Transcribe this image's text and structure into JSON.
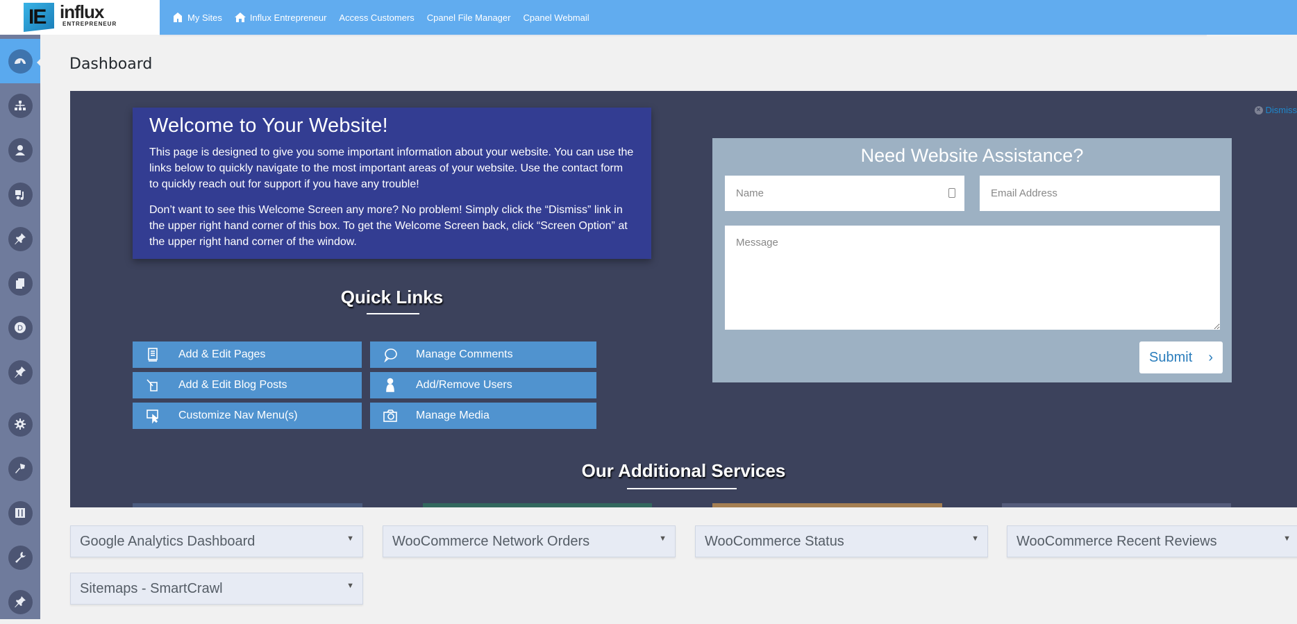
{
  "brand": {
    "mark": "IE",
    "name": "influx",
    "sub": "ENTREPRENEUR"
  },
  "topnav": [
    {
      "label": "My Sites",
      "icon": "sites-icon"
    },
    {
      "label": "Influx Entrepreneur",
      "icon": "home-icon"
    },
    {
      "label": "Access Customers",
      "icon": ""
    },
    {
      "label": "Cpanel File Manager",
      "icon": ""
    },
    {
      "label": "Cpanel Webmail",
      "icon": ""
    }
  ],
  "sidebar": [
    {
      "name": "dashboard",
      "icon": "dashboard-icon",
      "active": true
    },
    {
      "name": "my-sites",
      "icon": "sitemap-icon"
    },
    {
      "name": "users",
      "icon": "user-icon"
    },
    {
      "name": "media",
      "icon": "media-icon"
    },
    {
      "name": "posts",
      "icon": "pin-icon"
    },
    {
      "name": "pages",
      "icon": "pages-icon"
    },
    {
      "name": "divi",
      "icon": "divi-icon"
    },
    {
      "name": "pin-2",
      "icon": "pin-icon"
    },
    {
      "name": "settings",
      "icon": "gear-icon"
    },
    {
      "name": "appearance",
      "icon": "brush-icon"
    },
    {
      "name": "plugins",
      "icon": "sliders-icon"
    },
    {
      "name": "tools",
      "icon": "wrench-icon"
    },
    {
      "name": "pin-3",
      "icon": "pin-icon"
    }
  ],
  "page": {
    "title": "Dashboard"
  },
  "welcome": {
    "title": "Welcome to Your Website!",
    "p1": "This page is designed to give you some important information about your website. You can use the links below to quickly navigate to the most important areas of your website. Use the contact form to quickly reach out for support if you have any trouble!",
    "p2": "Don’t want to see this Welcome Screen any more? No problem! Simply click the “Dismiss” link in the upper right hand corner of this box. To get the Welcome Screen back, click “Screen Option” at the upper right hand corner of the window.",
    "dismiss": "Dismiss"
  },
  "quick_links": {
    "title": "Quick Links",
    "items": [
      {
        "label": "Add & Edit Pages",
        "icon": "pages-icon"
      },
      {
        "label": "Manage Comments",
        "icon": "comment-icon"
      },
      {
        "label": "Add & Edit Blog Posts",
        "icon": "edit-post-icon"
      },
      {
        "label": "Add/Remove Users",
        "icon": "user-icon"
      },
      {
        "label": "Customize Nav Menu(s)",
        "icon": "cursor-icon"
      },
      {
        "label": "Manage Media",
        "icon": "camera-icon"
      }
    ]
  },
  "assist": {
    "title": "Need Website Assistance?",
    "name_placeholder": "Name",
    "email_placeholder": "Email Address",
    "message_placeholder": "Message",
    "submit": "Submit",
    "submit_arrow": "›"
  },
  "services": {
    "title": "Our Additional Services",
    "card_colors": [
      "#4c5c7f",
      "#33685e",
      "#a57f52",
      "#555c7b"
    ]
  },
  "widgets": [
    "Google Analytics Dashboard",
    "WooCommerce Network Orders",
    "WooCommerce Status",
    "WooCommerce Recent Reviews",
    "Sitemaps - SmartCrawl"
  ],
  "colors": {
    "topbar": "#61acef",
    "sidebar": "#6f7b9c",
    "panel": "#3c425c",
    "welcome": "#333d92",
    "quicklink": "#5093cf",
    "assist": "#9db1c3"
  }
}
